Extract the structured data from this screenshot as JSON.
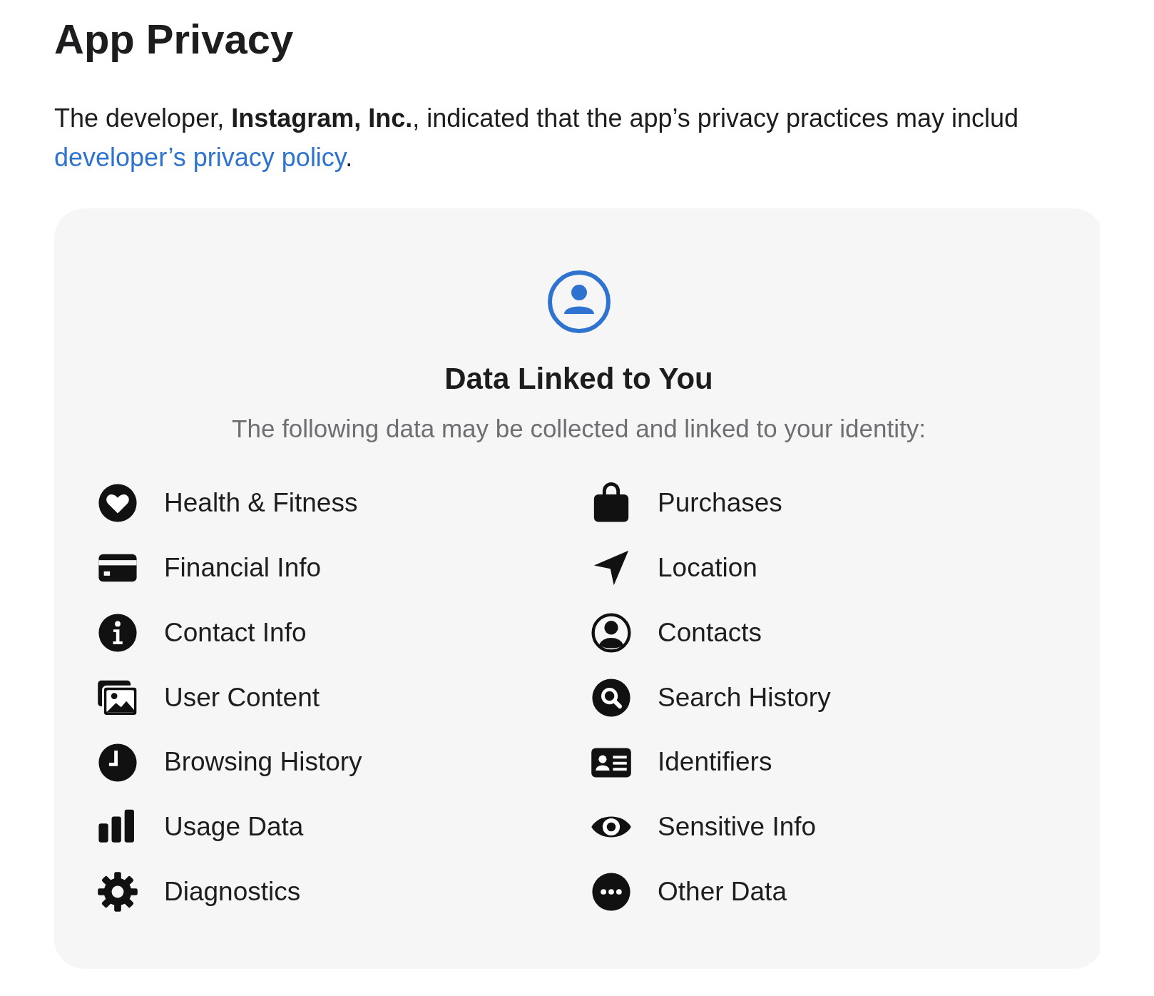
{
  "title": "App Privacy",
  "intro": {
    "text": "The developer, **Instagram, Inc.**, indicated that the app’s privacy practices may includ",
    "link": "developer’s privacy policy",
    "end": "."
  },
  "card": {
    "heading": "Data Linked to You",
    "subtitle": "The following data may be collected and linked to your identity:",
    "items": [
      {
        "label": "Health & Fitness"
      },
      {
        "label": "Financial Info"
      },
      {
        "label": "Contact Info"
      },
      {
        "label": "User Content"
      },
      {
        "label": "Browsing History"
      },
      {
        "label": "Usage Data"
      },
      {
        "label": "Diagnostics"
      },
      {
        "label": "Purchases"
      },
      {
        "label": "Location"
      },
      {
        "label": "Contacts"
      },
      {
        "label": "Search History"
      },
      {
        "label": "Identifiers"
      },
      {
        "label": "Sensitive Info"
      },
      {
        "label": "Other Data"
      }
    ]
  }
}
